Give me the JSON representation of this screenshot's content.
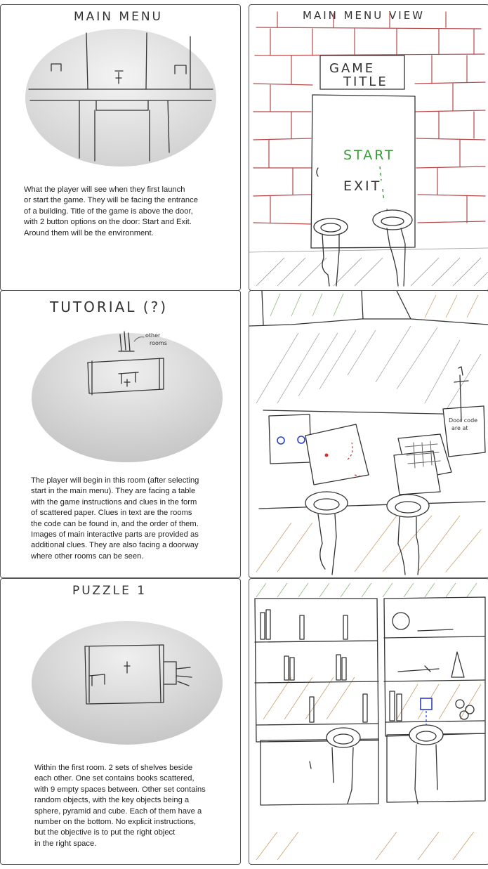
{
  "panels": {
    "main_menu": {
      "title": "MAIN MENU",
      "description": "What the player will see when they first launch\nor start the game. They will be facing the entrance\nof a building. Title of the game is above the door,\nwith 2 button options on the door: Start and Exit.\nAround them will be the environment."
    },
    "main_menu_view": {
      "title": "MAIN MENU VIEW",
      "game_title_line1": "GAME",
      "game_title_line2": "TITLE",
      "start_label": "START",
      "exit_label": "EXIT"
    },
    "tutorial": {
      "title": "TUTORIAL (?)",
      "other_rooms_note_line1": "other",
      "other_rooms_note_line2": "rooms",
      "description": "The player will begin in this room (after selecting\nstart in the main menu). They are facing a table\nwith the game instructions and clues in the form\nof scattered paper. Clues in text are the rooms\nthe code can be found in, and the order of them.\nImages of main interactive parts are provided as\nadditional clues. They are also facing a doorway\nwhere other rooms can be seen."
    },
    "tutorial_view": {
      "note_line1": "Door code",
      "note_line2": "are at"
    },
    "puzzle_1": {
      "title": "PUZZLE 1",
      "description": "Within the first room. 2 sets of shelves beside\neach other. One set contains books scattered,\nwith 9 empty spaces between. Other set contains\nrandom objects, with the key objects being a\nsphere, pyramid and cube. Each of them have a\nnumber on the bottom. No explicit instructions,\nbut the objective is to put the right object\nin the right space."
    }
  },
  "colors": {
    "brick": "#b8484a",
    "start_green": "#3a9a3a",
    "highlight_blue": "#2b3fc7",
    "highlight_red": "#d03030",
    "hatch_tan": "#c9a070",
    "hatch_green": "#8fb87a"
  }
}
